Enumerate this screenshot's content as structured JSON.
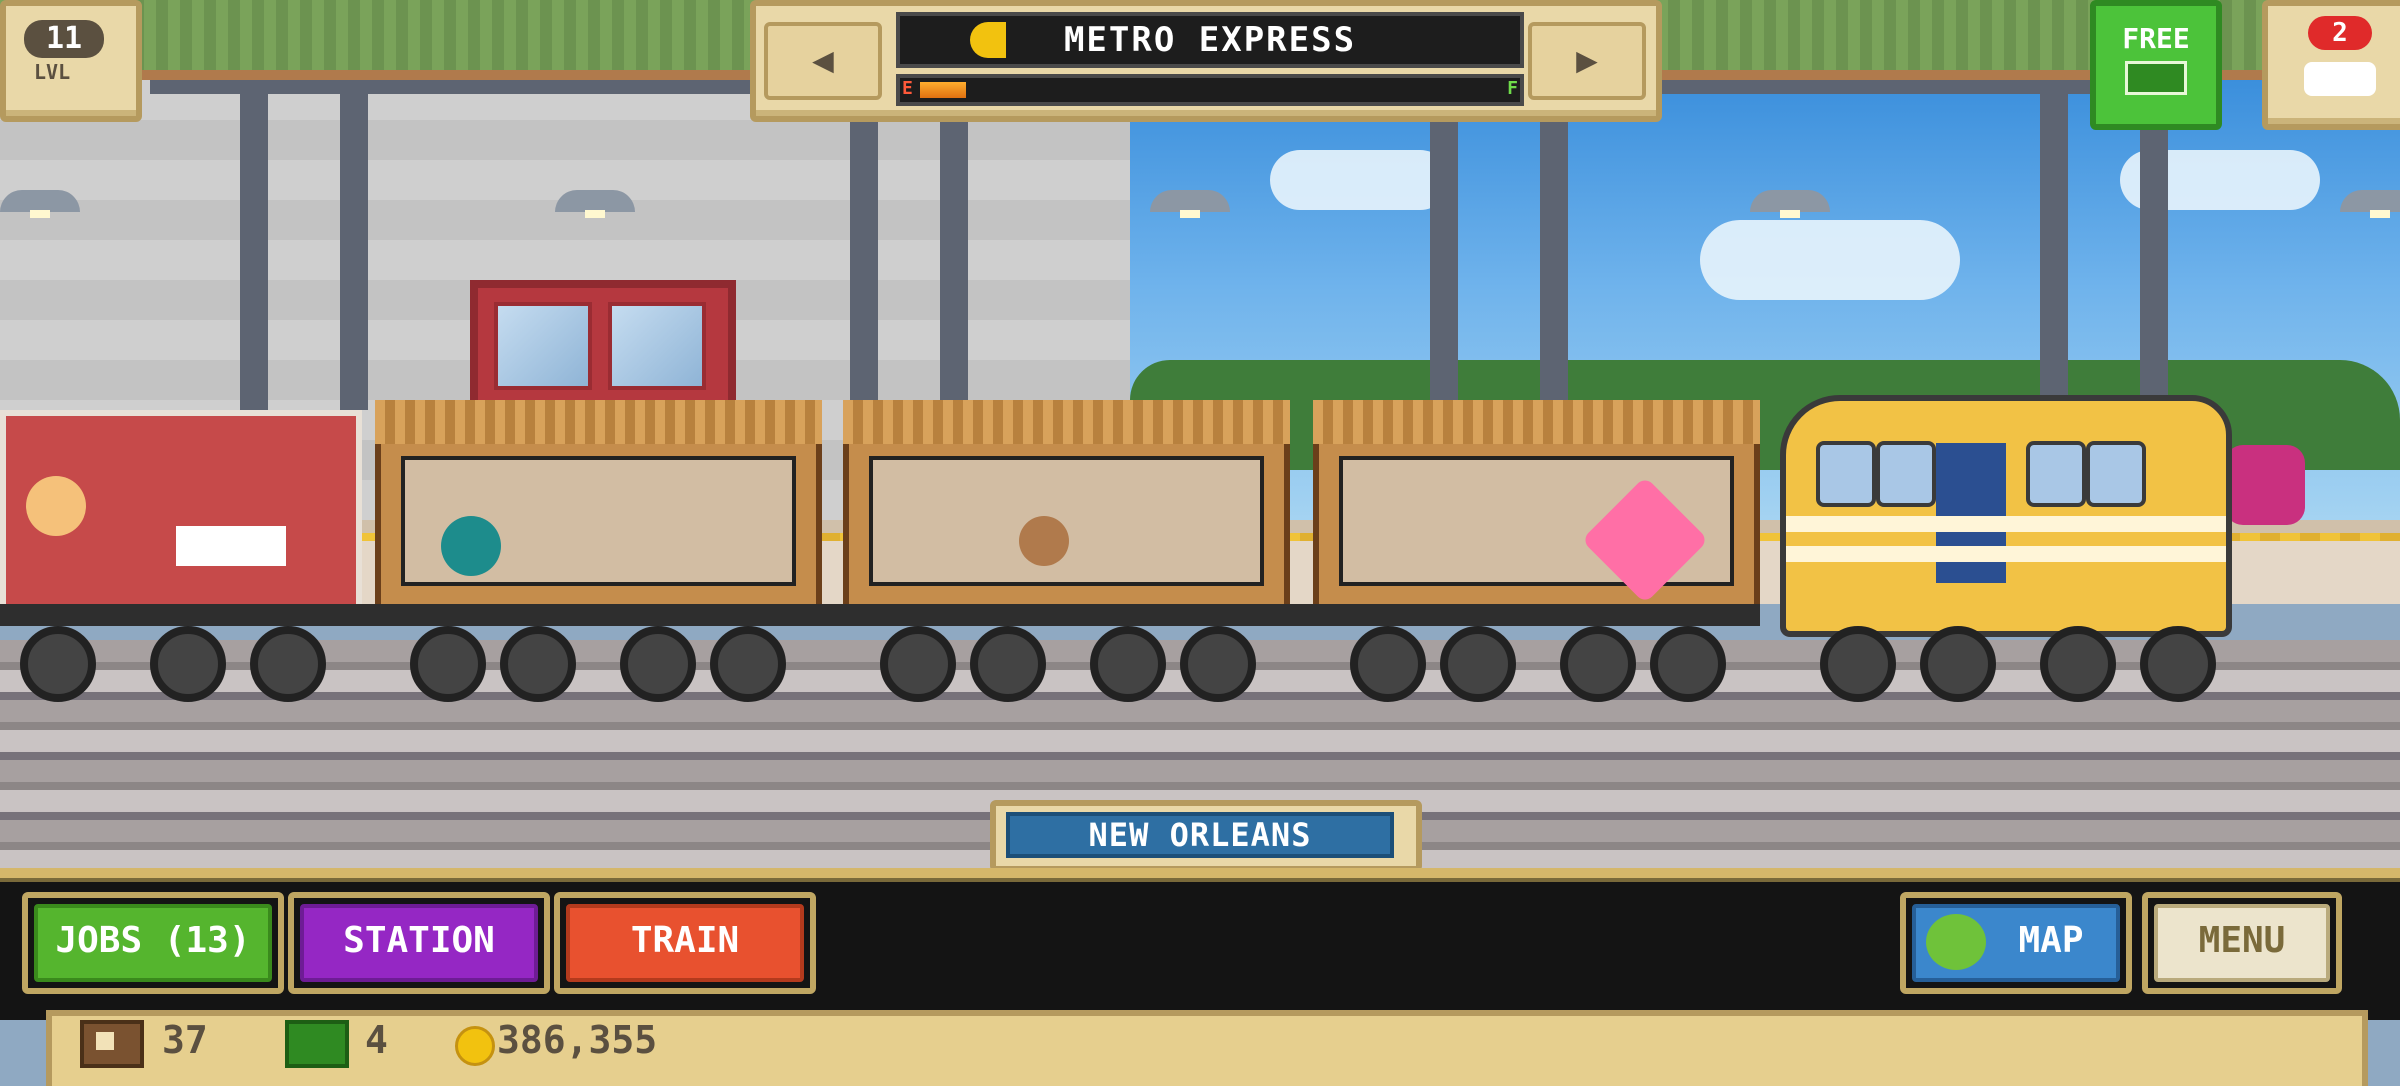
{
  "hud": {
    "level_number": "11",
    "level_label": "LVL",
    "train_name": "METRO EXPRESS",
    "fuel_empty_label": "E",
    "fuel_full_label": "F",
    "fuel_fraction": 0.08,
    "free_label": "FREE",
    "trains_badge": "2"
  },
  "destination": "NEW ORLEANS",
  "nav": {
    "jobs": "JOBS (13)",
    "station": "STATION",
    "train": "TRAIN",
    "map": "MAP",
    "menu": "MENU"
  },
  "currency": {
    "crates": "37",
    "bux": "4",
    "coins": "386,355"
  },
  "colors": {
    "jobs": "#55b52e",
    "station": "#9527c4",
    "train": "#e8512f",
    "map": "#3b87cc",
    "free": "#4cc33a",
    "destination": "#2e6fa3"
  }
}
